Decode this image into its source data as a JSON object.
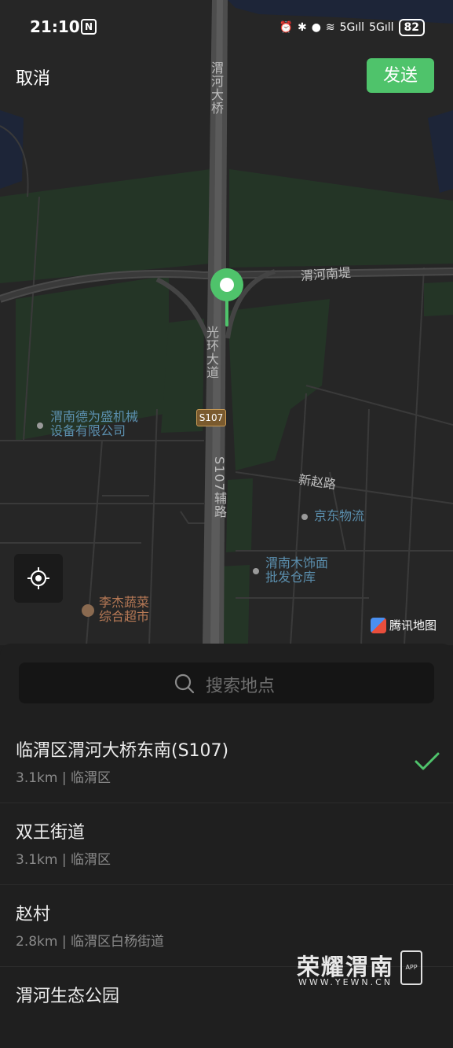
{
  "status_bar": {
    "time": "21:10",
    "nfc": "N",
    "icons": [
      "alarm-icon",
      "bluetooth-icon",
      "location-icon",
      "wifi-icon",
      "signal-5g-icon",
      "signal-5g-icon"
    ],
    "battery": "82"
  },
  "header": {
    "cancel_label": "取消",
    "send_label": "发送",
    "accent_color": "#4fc36b"
  },
  "map": {
    "labels": {
      "weihe_bridge": "渭河大桥",
      "weihe_south_dike": "渭河南堤",
      "guanghuan_avenue": "光环大道",
      "s107": "S107",
      "s107_aux_road": "S107辅路",
      "xinzhao_road": "新赵路",
      "poi_machinery_line1": "渭南德为盛机械",
      "poi_machinery_line2": "设备有限公司",
      "poi_jd": "京东物流",
      "poi_wood_line1": "渭南木饰面",
      "poi_wood_line2": "批发仓库",
      "poi_market_line1": "李杰蔬菜",
      "poi_market_line2": "综合超市"
    },
    "attribution": "腾讯地图"
  },
  "search": {
    "placeholder": "搜索地点"
  },
  "results": [
    {
      "name": "临渭区渭河大桥东南(S107)",
      "detail": "3.1km | 临渭区",
      "selected": true
    },
    {
      "name": "双王街道",
      "detail": "3.1km | 临渭区",
      "selected": false
    },
    {
      "name": "赵村",
      "detail": "2.8km | 临渭区白杨街道",
      "selected": false
    },
    {
      "name": "渭河生态公园",
      "detail": "",
      "selected": false
    }
  ],
  "watermark": {
    "title": "荣耀渭南",
    "url": "WWW.YEWN.CN",
    "badge": "APP"
  }
}
